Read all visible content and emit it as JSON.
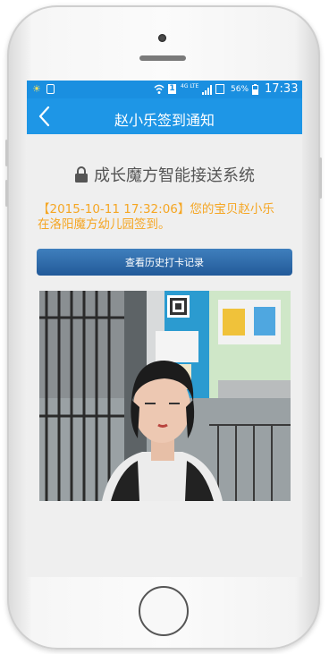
{
  "status_bar": {
    "battery": "56%",
    "time": "17:33",
    "network": "4G LTE"
  },
  "header": {
    "title": "赵小乐签到通知"
  },
  "system_title": "成长魔方智能接送系统",
  "notice": {
    "line1": "【2015-10-11 17:32:06】您的宝贝赵小乐",
    "line2": "在洛阳魔方幼儿园签到。"
  },
  "history_button": {
    "label": "查看历史打卡记录"
  },
  "colors": {
    "header": "#1e96e6",
    "status_bar": "#1a8fe0",
    "notice": "#f5a623",
    "button": "#2a64a3"
  },
  "icons": [
    "back-chevron-icon",
    "lock-icon",
    "wifi-icon",
    "signal-icon",
    "battery-icon"
  ]
}
